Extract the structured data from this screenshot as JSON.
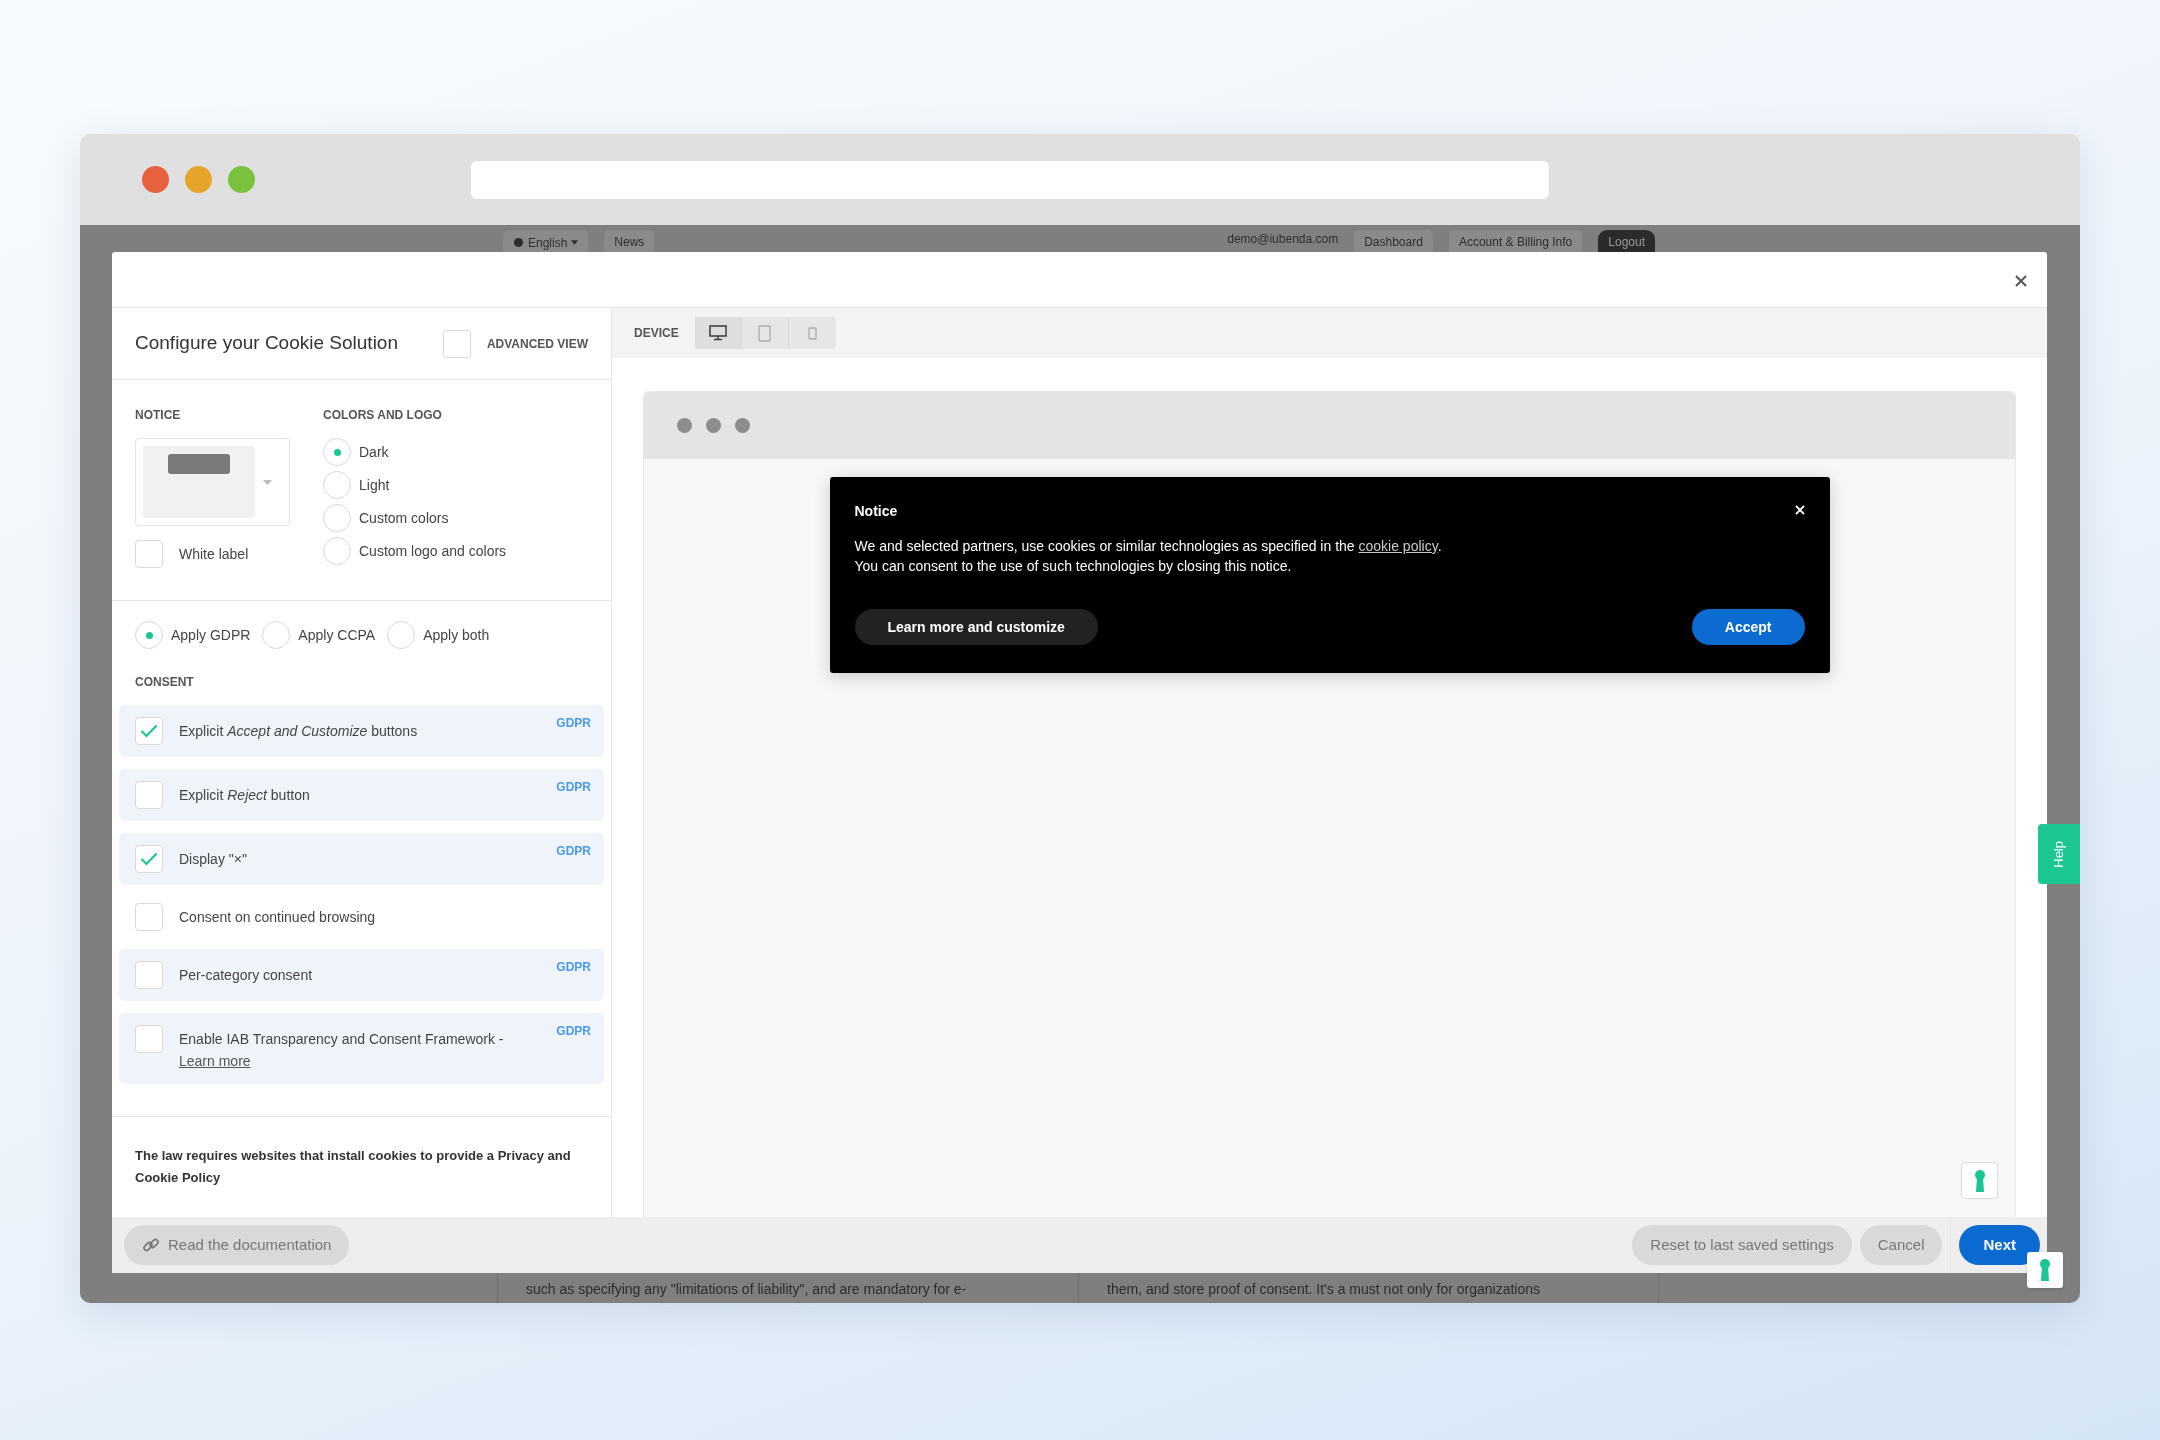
{
  "backdrop_nav": {
    "language": "English",
    "news": "News",
    "email": "demo@iubenda.com",
    "links": [
      "Dashboard",
      "Account & Billing Info"
    ],
    "logout": "Logout"
  },
  "backdrop_text": [
    "such as specifying any \"limitations of liability\", and are mandatory for e-",
    "them, and store proof of consent. It's a must not only for organizations"
  ],
  "modal": {
    "title": "Configure your Cookie Solution",
    "advanced_view": {
      "label": "ADVANCED VIEW",
      "checked": false
    },
    "notice_section": {
      "heading": "NOTICE",
      "white_label": {
        "label": "White label",
        "checked": false
      }
    },
    "colors_section": {
      "heading": "COLORS AND LOGO",
      "options": [
        {
          "label": "Dark",
          "selected": true
        },
        {
          "label": "Light",
          "selected": false
        },
        {
          "label": "Custom colors",
          "selected": false
        },
        {
          "label": "Custom logo and colors",
          "selected": false
        }
      ]
    },
    "laws": [
      {
        "label": "Apply GDPR",
        "selected": true
      },
      {
        "label": "Apply CCPA",
        "selected": false
      },
      {
        "label": "Apply both",
        "selected": false
      }
    ],
    "consent": {
      "heading": "CONSENT",
      "items": [
        {
          "text": "Explicit *Accept and Customize* buttons",
          "checked": true,
          "tag": "GDPR"
        },
        {
          "text": "Explicit *Reject* button",
          "checked": false,
          "tag": "GDPR"
        },
        {
          "text": "Display \"×\"",
          "checked": true,
          "tag": "GDPR"
        },
        {
          "text": "Consent on continued browsing",
          "checked": false
        },
        {
          "text": "Per-category consent",
          "checked": false,
          "tag": "GDPR"
        },
        {
          "text": "Enable IAB Transparency and Consent Framework -",
          "link": "Learn more",
          "checked": false,
          "tag": "GDPR"
        }
      ]
    },
    "policy_note": "The law requires websites that install cookies to provide a Privacy and Cookie Policy",
    "device": {
      "label": "DEVICE",
      "options": [
        {
          "kind": "desktop",
          "selected": true
        },
        {
          "kind": "tablet",
          "selected": false
        },
        {
          "kind": "phone",
          "selected": false
        }
      ]
    },
    "preview_notice": {
      "title": "Notice",
      "text_before": "We and selected partners, use cookies or similar technologies as specified in the ",
      "link": "cookie policy",
      "text_after": ".",
      "line2": "You can consent to the use of such technologies by closing this notice.",
      "secondary_button": "Learn more and customize",
      "primary_button": "Accept"
    },
    "footer": {
      "docs_button": "Read the documentation",
      "reset_button": "Reset to last saved settings",
      "cancel_button": "Cancel",
      "next_button": "Next"
    }
  },
  "help_tab": "Help"
}
